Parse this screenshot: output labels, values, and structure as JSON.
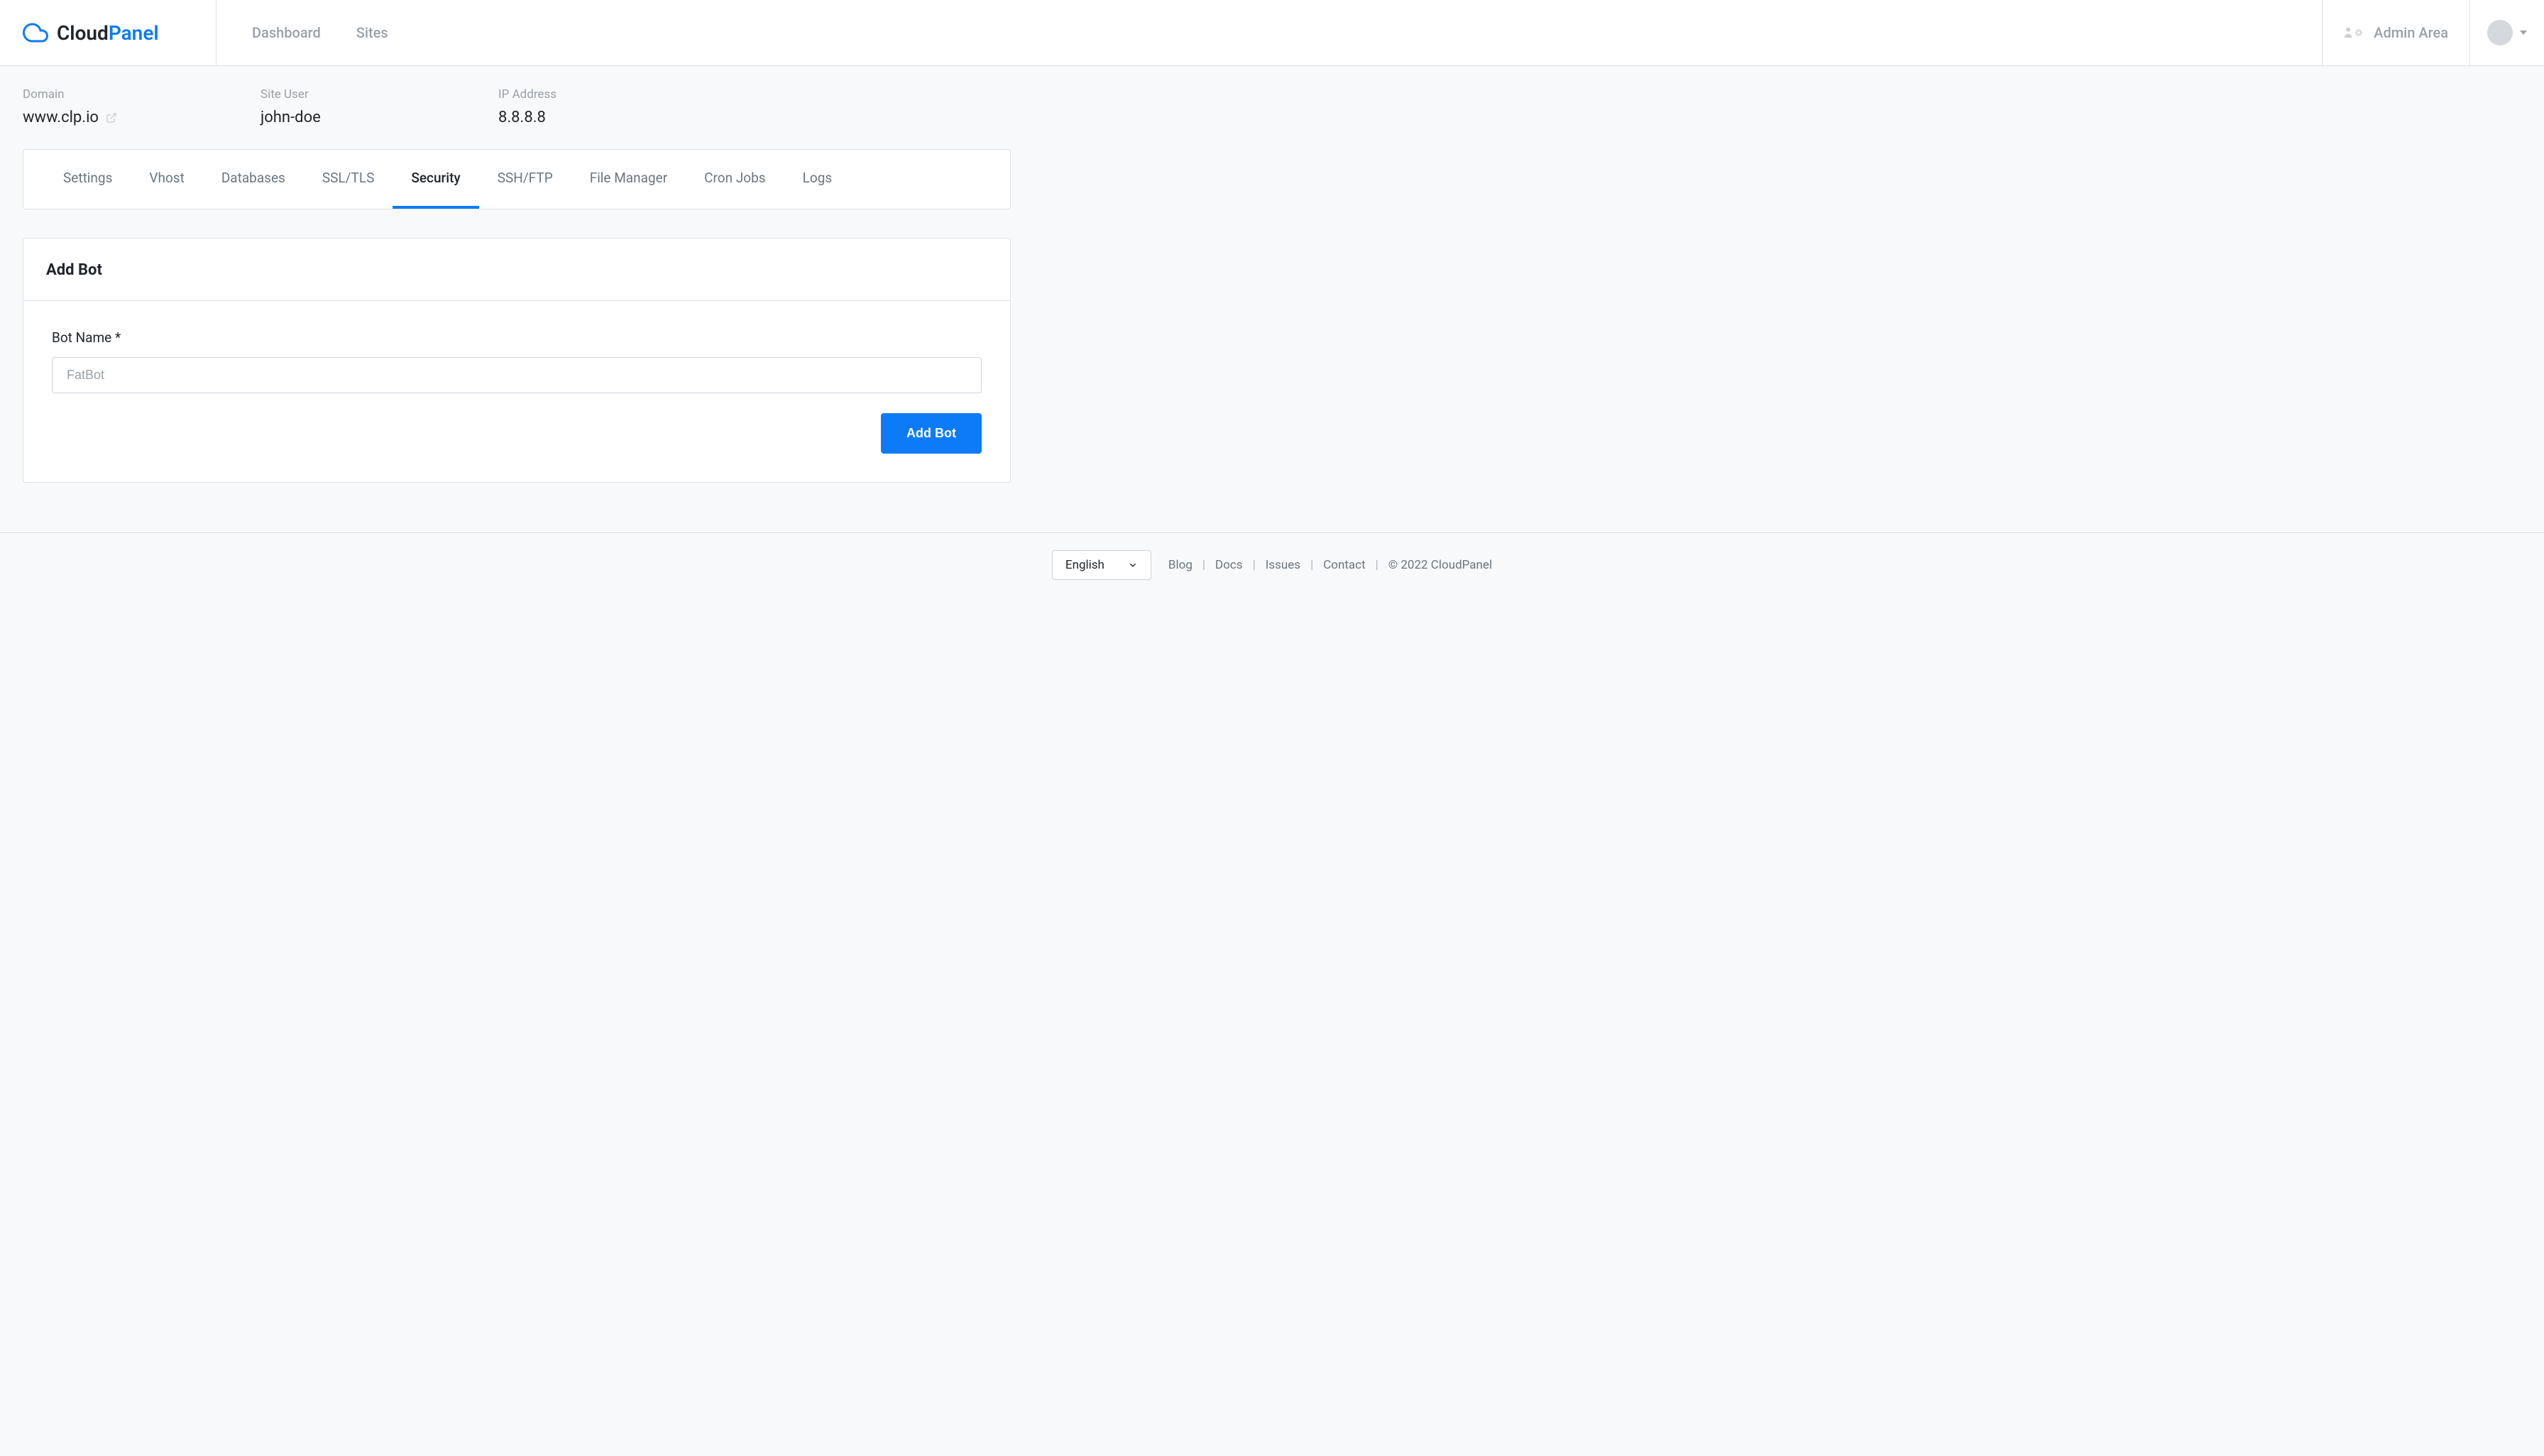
{
  "brand": {
    "text_1": "Cloud",
    "text_2": "Panel"
  },
  "header": {
    "nav": [
      {
        "label": "Dashboard"
      },
      {
        "label": "Sites"
      }
    ],
    "admin_area": "Admin Area"
  },
  "site_info": {
    "domain_label": "Domain",
    "domain_value": "www.clp.io",
    "user_label": "Site User",
    "user_value": "john-doe",
    "ip_label": "IP Address",
    "ip_value": "8.8.8.8"
  },
  "tabs": [
    {
      "label": "Settings",
      "active": false
    },
    {
      "label": "Vhost",
      "active": false
    },
    {
      "label": "Databases",
      "active": false
    },
    {
      "label": "SSL/TLS",
      "active": false
    },
    {
      "label": "Security",
      "active": true
    },
    {
      "label": "SSH/FTP",
      "active": false
    },
    {
      "label": "File Manager",
      "active": false
    },
    {
      "label": "Cron Jobs",
      "active": false
    },
    {
      "label": "Logs",
      "active": false
    }
  ],
  "card": {
    "title": "Add Bot",
    "field_label": "Bot Name *",
    "field_placeholder": "FatBot",
    "submit_label": "Add Bot"
  },
  "footer": {
    "language": "English",
    "links": [
      {
        "label": "Blog"
      },
      {
        "label": "Docs"
      },
      {
        "label": "Issues"
      },
      {
        "label": "Contact"
      }
    ],
    "copyright": "© 2022  CloudPanel"
  }
}
